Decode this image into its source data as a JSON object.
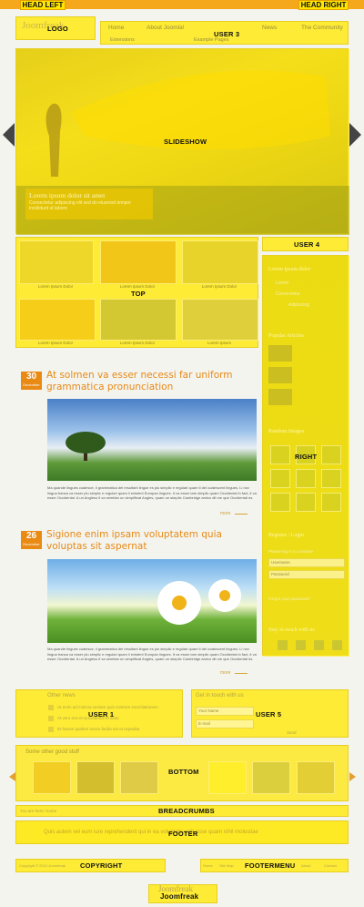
{
  "positions": {
    "head_left": "HEAD LEFT",
    "head_right": "HEAD RIGHT",
    "logo": "LOGO",
    "user3": "USER 3",
    "slideshow": "SLIDESHOW",
    "user4": "USER 4",
    "top": "TOP",
    "right": "RIGHT",
    "user1": "USER 1",
    "user5": "USER 5",
    "bottom": "BOTTOM",
    "breadcrumbs": "BREADCRUMBS",
    "footer": "FOOTER",
    "copyright": "COPYRIGHT",
    "footermenu": "FOOTERMENU"
  },
  "logo_text": "Joomfreak",
  "nav": {
    "items": [
      "Home",
      "About Joomla!",
      "News",
      "The Community"
    ],
    "sub_items": [
      "Extensions",
      "Example Pages"
    ]
  },
  "slideshow": {
    "caption_title": "Lorem ipsum dolor sit amet",
    "caption_text": "Consectetur adipiscing elit sed do eiusmod tempor incididunt ut labore"
  },
  "top_thumbs": {
    "captions": [
      "Lorem Ipsum Dolor",
      "Lorem Ipsum Dolor",
      "Lorem Ipsum Dolor",
      "Lorem Ipsum Dolor",
      "Lorem Ipsum Dolor",
      "Lorem Ipsum"
    ]
  },
  "sidebar": {
    "menu_head": "Lorem ipsum dolor",
    "menu_items": [
      "Lorem",
      "Consectetur",
      "Adipiscing"
    ],
    "popular_head": "Popular Articles",
    "gallery_head": "Random Images",
    "login_head": "Register / Login",
    "login_prompt": "Please log in to continue",
    "username_placeholder": "Username",
    "password_placeholder": "Password",
    "forgot_text": "Forgot your password?",
    "social_head": "Stay in touch with us"
  },
  "articles": [
    {
      "day": "30",
      "month": "December",
      "title": "At solmen va esser necessi far uniform grammatica pronunciation",
      "body": "Ma quande lingues coalesce, li grammatica del resultant lingue es plu simplic e regulari quam ti del coalescent lingues. Li nov lingua franca va esser plu simplic e regulari quam li existent Europan lingues. It va esser tam simplic quam Occidental in fact, it va esser Occidental. A un Angleso it va semblar un simplificat Angles, quam un skeptic Cambridge amico dit me que Occidental es.",
      "more": "more"
    },
    {
      "day": "26",
      "month": "December",
      "title": "Sigione enim ipsam voluptatem quia voluptas sit aspernat",
      "body": "Ma quande lingues coalesce, li grammatica del resultant lingue es plu simplic e regulari quam ti del coalescent lingues. Li nov lingua franca va esser plu simplic e regulari quam li existent Europan lingues. It va esser tam simplic quam Occidental in fact, it va esser Occidental. A un Angleso it va semblar un simplificat Angles, quam un skeptic Cambridge amico dit me que Occidental es.",
      "more": "more"
    }
  ],
  "user1": {
    "head": "Other news",
    "items": [
      "Ut enim ad minima veniam quis nostrum exercitationem",
      "At vero eos et accusamus et iusto",
      "Et harum quidem rerum facilis est et expedita"
    ]
  },
  "user5": {
    "head": "Get in touch with us",
    "name_placeholder": "Your Name",
    "email_placeholder": "E-mail",
    "send_label": "Send"
  },
  "bottom": {
    "head": "Some other good stuff"
  },
  "breadcrumbs_text": "You are here: Home",
  "footer_text": "Quis autem vel eum iure reprehenderit qui in ea voluptate velit esse quam nihil molestiae",
  "copyright_text": "Copyright © 2012 Joomfreak",
  "footermenu_items": [
    "Home",
    "Site Map",
    "About",
    "Contact"
  ],
  "colors": {
    "overlay": "#ffe600",
    "accent": "#e98a14",
    "topbar": "#f6a81c"
  }
}
